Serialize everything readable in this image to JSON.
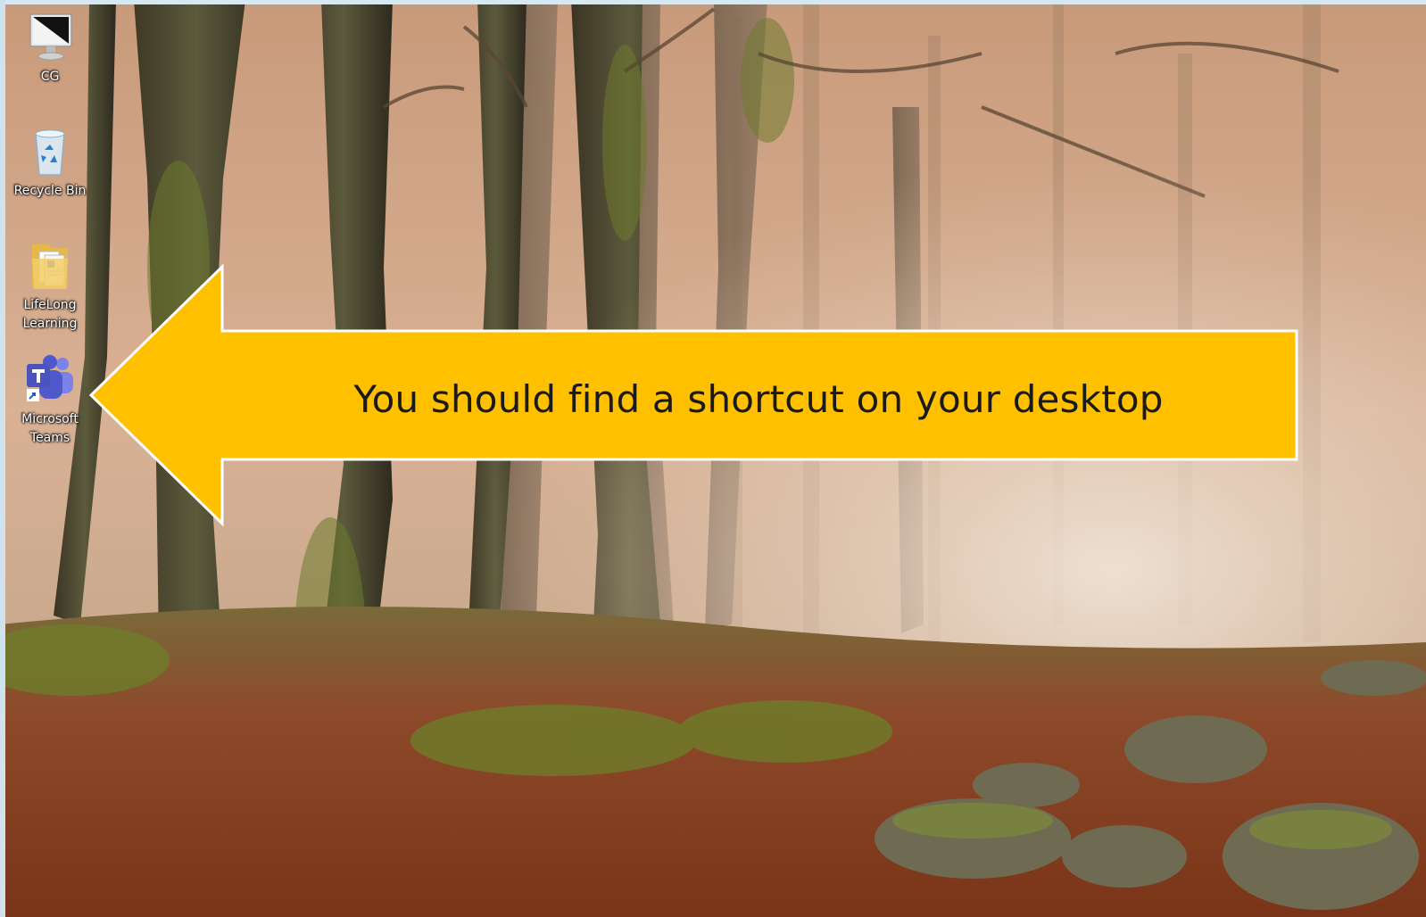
{
  "desktop": {
    "icons": [
      {
        "label": "CG",
        "icon": "monitor-icon"
      },
      {
        "label": "Recycle Bin",
        "icon": "recycle-bin-icon"
      },
      {
        "label": "LifeLong Learning",
        "icon": "folder-icon"
      },
      {
        "label": "Microsoft Teams",
        "icon": "teams-icon"
      }
    ]
  },
  "callout": {
    "text": "You should find a shortcut on your desktop",
    "color": "#ffc000",
    "outline": "#ffffff"
  }
}
